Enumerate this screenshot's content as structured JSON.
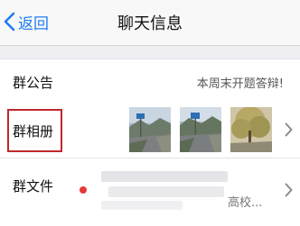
{
  "nav": {
    "back_label": "返回",
    "title": "聊天信息"
  },
  "group_notice": {
    "label": "群公告",
    "value": "本周末开题答辩!"
  },
  "group_album": {
    "label": "群相册",
    "thumbnails": [
      "street-photo",
      "street-photo",
      "tree-photo"
    ]
  },
  "group_files": {
    "label": "群文件",
    "preview_tail": "高校..."
  },
  "colors": {
    "accent": "#1d7cf2",
    "highlight_box": "#c1272d",
    "unread_dot": "#e53935"
  }
}
